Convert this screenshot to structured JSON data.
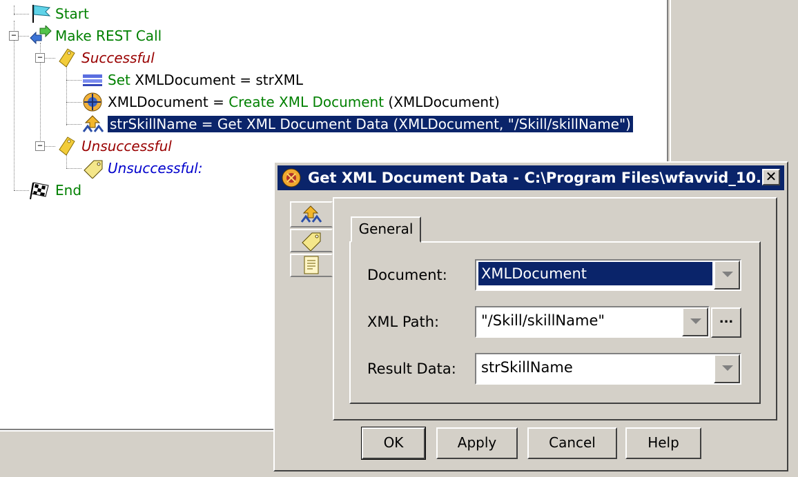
{
  "tree": {
    "start": "Start",
    "rest_call": "Make REST Call",
    "successful": "Successful",
    "set_keyword": "Set",
    "set_rest": " XMLDocument = strXML",
    "create_prefix": "XMLDocument = ",
    "create_name": "Create XML Document",
    "create_suffix": " (XMLDocument)",
    "selected_step": "strSkillName = Get XML Document Data (XMLDocument, \"/Skill/skillName\")",
    "unsuccessful": "Unsuccessful",
    "unsuccessful_label": "Unsuccessful:",
    "end": "End"
  },
  "dialog": {
    "title": "Get XML Document Data - C:\\Program Files\\wfavvid_10...",
    "close_glyph": "✕",
    "tab_general": "General",
    "fields": {
      "document_label": "Document:",
      "document_value": "XMLDocument",
      "xml_path_label": "XML Path:",
      "xml_path_value": "\"/Skill/skillName\"",
      "browse_label": "...",
      "result_label": "Result Data:",
      "result_value": "strSkillName"
    },
    "buttons": {
      "ok": "OK",
      "apply": "Apply",
      "cancel": "Cancel",
      "help": "Help"
    }
  },
  "colors": {
    "selection": "#0a246a",
    "step_green": "#008000",
    "branch_red": "#990000",
    "label_blue": "#0000cc",
    "window_face": "#d4d0c8"
  },
  "icons": [
    "start-flag-icon",
    "rest-call-icon",
    "branch-tag-icon",
    "set-step-icon",
    "xml-doc-icon",
    "get-xml-data-icon",
    "label-tag-icon",
    "end-flag-icon",
    "document-page-icon"
  ]
}
